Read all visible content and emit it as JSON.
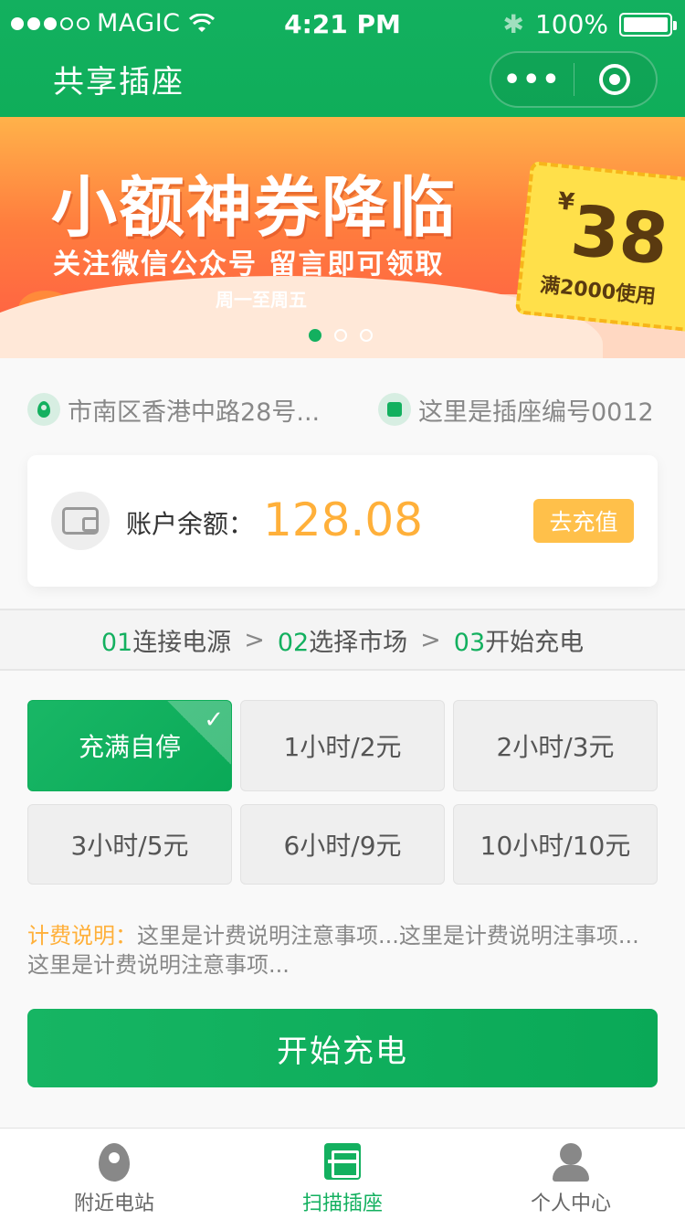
{
  "status_bar": {
    "carrier": "MAGIC",
    "time": "4:21 PM",
    "battery": "100%"
  },
  "nav": {
    "title": "共享插座",
    "more_label": "•••"
  },
  "banner": {
    "headline": "小额神券降临",
    "subline": "关注微信公众号  留言即可领取",
    "small": "周一至周五",
    "coupon_currency": "¥",
    "coupon_amount": "38",
    "coupon_condition": "满2000使用",
    "slides": 3,
    "active_slide": 1
  },
  "location": {
    "address": "市南区香港中路28号...",
    "socket_id": "这里是插座编号0012"
  },
  "balance": {
    "label": "账户余额：",
    "amount": "128.08",
    "recharge_label": "去充值"
  },
  "steps": [
    {
      "num": "01",
      "label": "连接电源"
    },
    {
      "num": "02",
      "label": "选择市场"
    },
    {
      "num": "03",
      "label": "开始充电"
    }
  ],
  "step_arrow": ">",
  "options": [
    {
      "label": "充满自停",
      "selected": true
    },
    {
      "label": "1小时/2元",
      "selected": false
    },
    {
      "label": "2小时/3元",
      "selected": false
    },
    {
      "label": "3小时/5元",
      "selected": false
    },
    {
      "label": "6小时/9元",
      "selected": false
    },
    {
      "label": "10小时/10元",
      "selected": false
    }
  ],
  "note": {
    "label": "计费说明：",
    "text": "这里是计费说明注意事项...这里是计费说明注事项...这里是计费说明注意事项..."
  },
  "start_button": "开始充电",
  "tabs": [
    {
      "label": "附近电站",
      "icon": "location-pin-icon",
      "active": false
    },
    {
      "label": "扫描插座",
      "icon": "scan-icon",
      "active": true
    },
    {
      "label": "个人中心",
      "icon": "user-icon",
      "active": false
    }
  ],
  "colors": {
    "brand_green": "#13b05f",
    "accent_orange": "#ffb03a",
    "recharge_bg": "#ffc04a"
  }
}
